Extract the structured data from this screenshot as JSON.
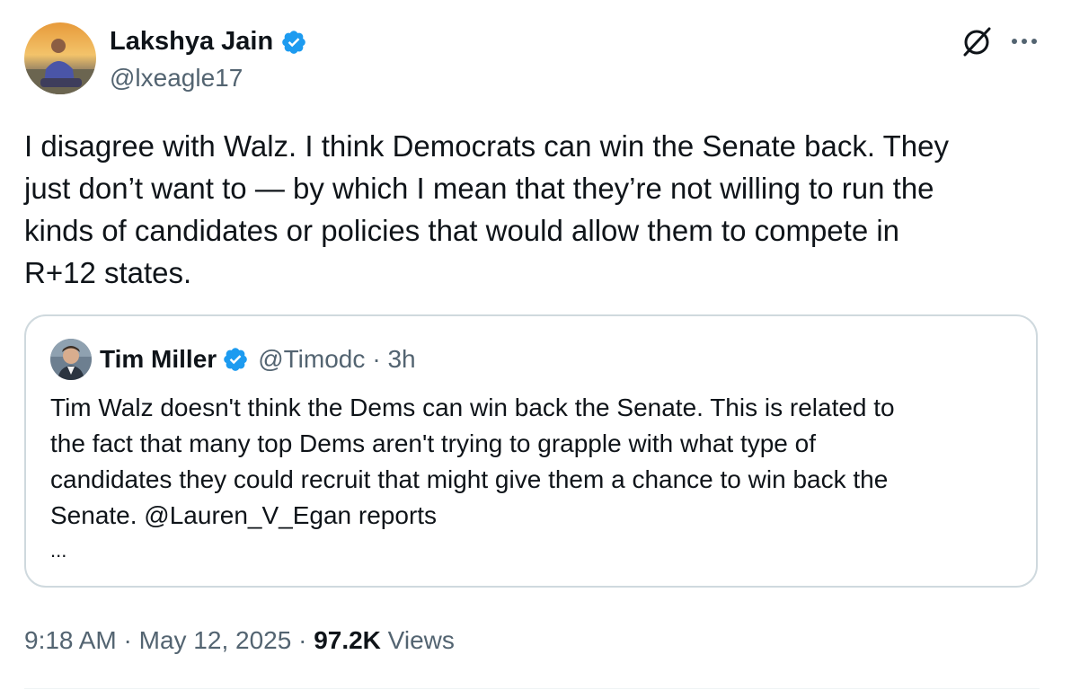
{
  "author": {
    "name": "Lakshya Jain",
    "handle": "@lxeagle17",
    "verified": true
  },
  "tweet": {
    "text": "I disagree with Walz. I think Democrats can win the Senate back. They\njust don’t want to — by which I mean that they’re not willing to run the\nkinds of candidates or policies that would allow them to compete in\nR+12 states."
  },
  "quote": {
    "name": "Tim Miller",
    "handle": "@Timodc",
    "time": "· 3h",
    "verified": true,
    "text": "Tim Walz doesn't think the Dems can win back the Senate. This is related to\nthe fact that many top Dems aren't trying to grapple with what type of\ncandidates they could recruit that might give them a chance to win back the\nSenate. @Lauren_V_Egan reports",
    "ellipsis": "..."
  },
  "meta": {
    "time": "9:18 AM",
    "sep1": " · ",
    "date": "May 12, 2025",
    "sep2": " · ",
    "views_count": "97.2K",
    "views_label": " Views"
  },
  "icons": [
    "grok-icon",
    "more-icon",
    "verified-badge-icon"
  ],
  "colors": {
    "accent_blue": "#1d9bf0",
    "text": "#0f1419",
    "secondary_text": "#536471",
    "border": "#cfd9de"
  }
}
